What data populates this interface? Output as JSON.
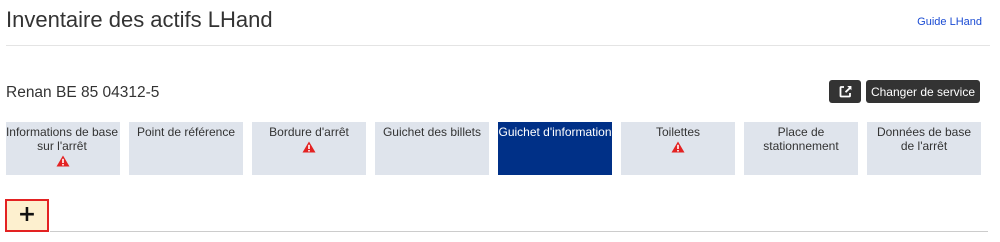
{
  "header": {
    "title": "Inventaire des actifs LHand",
    "guide_link": "Guide LHand"
  },
  "station": {
    "name": "Renan BE 85 04312-5"
  },
  "toolbar": {
    "change_service_label": "Changer de service",
    "export_icon": "external-link-icon"
  },
  "tabs": [
    {
      "label": "Informations de base sur l'arrêt",
      "warning": true,
      "active": false
    },
    {
      "label": "Point de référence",
      "warning": false,
      "active": false
    },
    {
      "label": "Bordure d'arrêt",
      "warning": true,
      "active": false
    },
    {
      "label": "Guichet des billets",
      "warning": false,
      "active": false
    },
    {
      "label": "Guichet d'information",
      "warning": false,
      "active": true
    },
    {
      "label": "Toilettes",
      "warning": true,
      "active": false
    },
    {
      "label": "Place de stationnement",
      "warning": false,
      "active": false
    },
    {
      "label": "Données de base de l'arrêt",
      "warning": false,
      "active": false
    }
  ],
  "add_button": {
    "label": "+"
  },
  "colors": {
    "tab_background": "#dfe4ec",
    "tab_active": "#003087",
    "warning": "#e32222",
    "dark_button": "#333333",
    "add_button_bg": "#fdf0cf"
  }
}
